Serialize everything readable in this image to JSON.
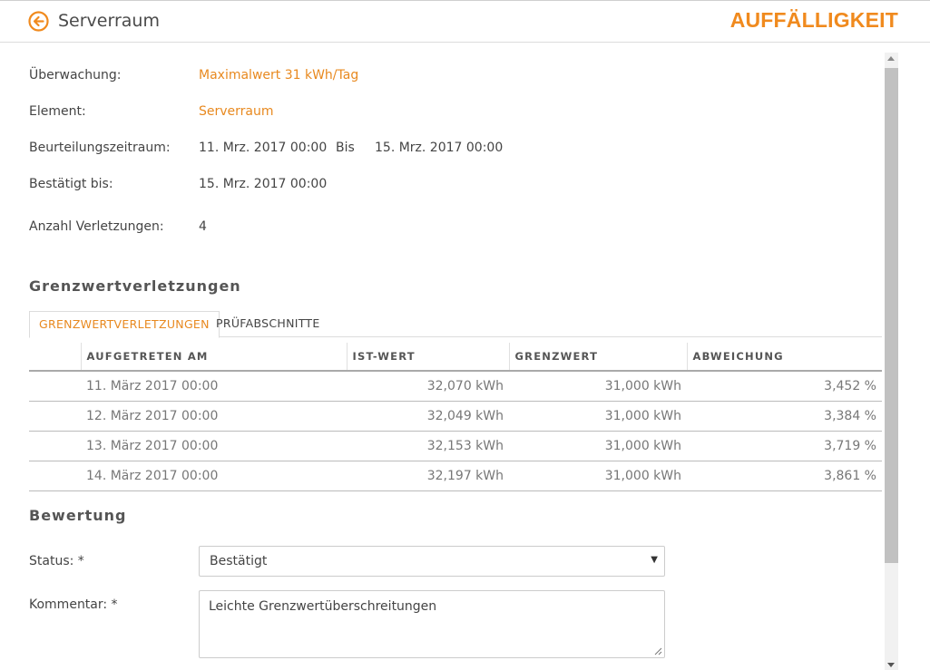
{
  "header": {
    "title": "Serverraum",
    "badge": "AUFFÄLLIGKEIT",
    "accent_color": "#f08a1e",
    "back_icon": "arrow-left-circle-icon"
  },
  "details": {
    "monitoring_label": "Überwachung:",
    "monitoring_value": "Maximalwert 31 kWh/Tag",
    "element_label": "Element:",
    "element_value": "Serverraum",
    "period_label": "Beurteilungszeitraum:",
    "period_from": "11. Mrz. 2017 00:00",
    "period_sep": "Bis",
    "period_to": "15. Mrz. 2017 00:00",
    "confirmed_label": "Bestätigt bis:",
    "confirmed_value": "15. Mrz. 2017 00:00",
    "violations_label": "Anzahl Verletzungen:",
    "violations_value": "4"
  },
  "violations_section": {
    "title": "Grenzwertverletzungen",
    "tabs": [
      {
        "label": "GRENZWERTVERLETZUNGEN",
        "active": true
      },
      {
        "label": "PRÜFABSCHNITTE",
        "active": false
      }
    ],
    "columns": [
      "",
      "AUFGETRETEN AM",
      "IST-WERT",
      "GRENZWERT",
      "ABWEICHUNG"
    ],
    "rows": [
      [
        "11. März 2017 00:00",
        "32,070 kWh",
        "31,000 kWh",
        "3,452 %"
      ],
      [
        "12. März 2017 00:00",
        "32,049 kWh",
        "31,000 kWh",
        "3,384 %"
      ],
      [
        "13. März 2017 00:00",
        "32,153 kWh",
        "31,000 kWh",
        "3,719 %"
      ],
      [
        "14. März 2017 00:00",
        "32,197 kWh",
        "31,000 kWh",
        "3,861 %"
      ]
    ]
  },
  "assessment": {
    "title": "Bewertung",
    "status_label": "Status: *",
    "status_value": "Bestätigt",
    "comment_label": "Kommentar: *",
    "comment_value": "Leichte Grenzwertüberschreitungen"
  }
}
